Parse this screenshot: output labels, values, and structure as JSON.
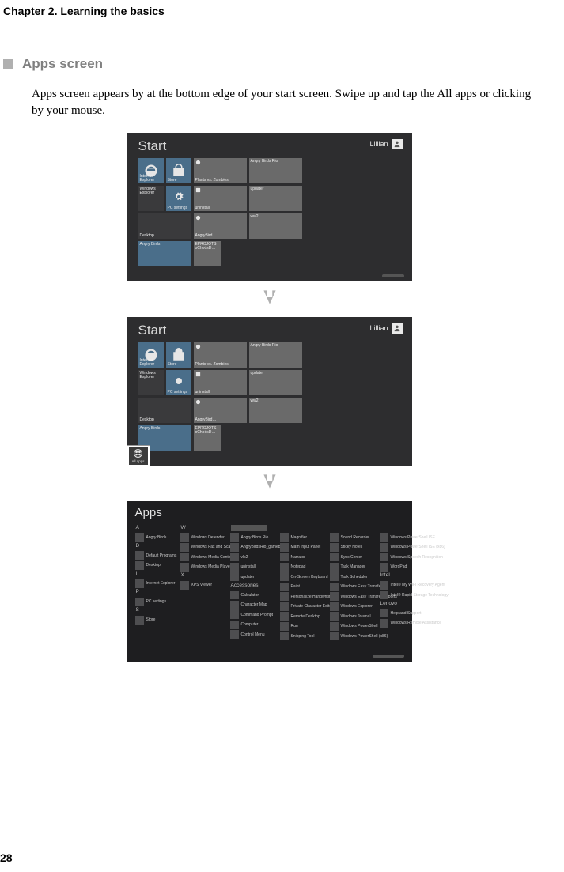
{
  "chapter_header": "Chapter 2. Learning the basics",
  "section_title": "Apps screen",
  "intro_text": "Apps screen appears by at the bottom edge of your start screen. Swipe up and  tap the All apps or clicking by your mouse.",
  "page_number": "28",
  "start": {
    "title": "Start",
    "user": "Lillian",
    "tiles": {
      "ie": "Internet Explorer",
      "store": "Store",
      "plants": "Plants vs. Zombies",
      "angry_rio": "Angry Birds Rio",
      "win_explorer": "Windows Explorer",
      "pc_settings": "PC settings",
      "uninstall": "uninstall",
      "updater": "updater",
      "desktop": "Desktop",
      "angrybird": "AngryBird…",
      "ww2": "ww2",
      "angry_birds": "Angry Birds",
      "eprojots": "EPROJOTS oChoósD…"
    },
    "all_apps_label": "All apps"
  },
  "apps": {
    "title": "Apps",
    "letters": {
      "A": "A",
      "D": "D",
      "I": "I",
      "P": "P",
      "S": "S",
      "W": "W",
      "X": "X"
    },
    "col1": {
      "a0": "Angry Birds",
      "d0": "Default Programs",
      "d1": "Desktop",
      "i0": "Internet Explorer",
      "p0": "PC settings",
      "s0": "Store"
    },
    "col2": {
      "w0": "Windows Defender",
      "w1": "Windows Fax and Scan",
      "w2": "Windows Media Center",
      "w3": "Windows Media Player",
      "x0": "XPS Viewer"
    },
    "col3": {
      "c0": "Angry Birds Rio",
      "c1": "AngryBirdsRio_gamebar",
      "c2": "vlc2",
      "c3": "uninstall",
      "c4": "updater",
      "hdr_acc": "Accessories",
      "a0": "Calculator",
      "a1": "Character Map",
      "a2": "Command Prompt",
      "a3": "Computer",
      "a4": "Control Menu"
    },
    "col4": {
      "c0": "Magnifier",
      "c1": "Math Input Panel",
      "c2": "Narrator",
      "c3": "Notepad",
      "c4": "On-Screen Keyboard",
      "c5": "Paint",
      "c6": "Personalize Handwriting…",
      "c7": "Private Character Editor",
      "c8": "Remote Desktop",
      "c9": "Run",
      "c10": "Snipping Tool"
    },
    "col5": {
      "c0": "Sound Recorder",
      "c1": "Sticky Notes",
      "c2": "Sync Center",
      "c3": "Task Manager",
      "c4": "Task Scheduler",
      "c5": "Windows Easy Transfer",
      "c6": "Windows Easy Transfer Reports",
      "c7": "Windows Explorer",
      "c8": "Windows Journal",
      "c9": "Windows PowerShell",
      "c10": "Windows PowerShell (x86)"
    },
    "col6": {
      "c0": "Windows PowerShell ISE",
      "c1": "Windows PowerShell ISE (x86)",
      "c2": "Windows Speech Recognition",
      "c3": "WordPad",
      "hdr_int": "Intel",
      "i0": "Intel® My WiFi Recovery Agent",
      "i1": "Intel® Rapid Storage Technology",
      "hdr_len": "Lenovo",
      "l0": "Help and Support",
      "l1": "Windows Remote Assistance"
    }
  }
}
